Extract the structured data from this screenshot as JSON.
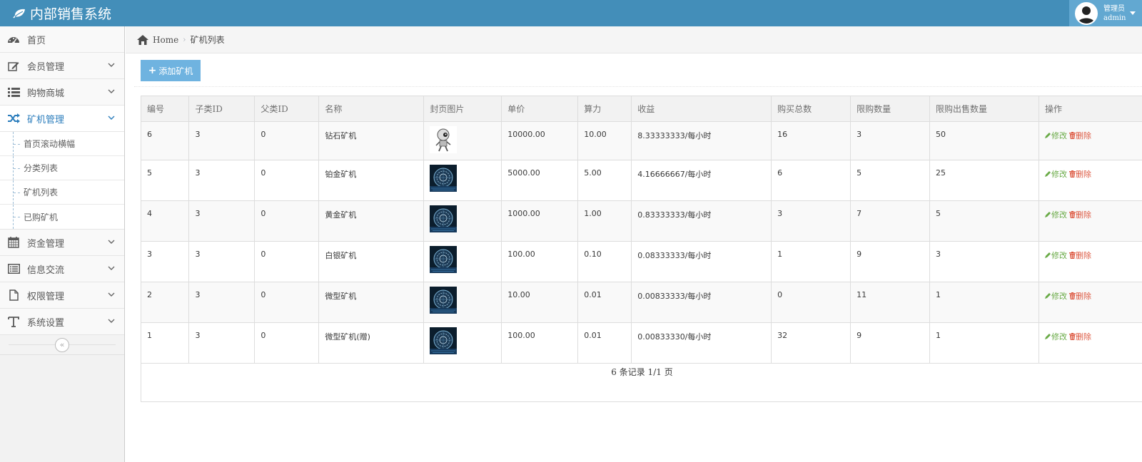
{
  "header": {
    "brand": "内部销售系统",
    "user_role": "管理员",
    "user_name": "admin"
  },
  "sidebar": {
    "items": [
      {
        "label": "首页",
        "icon": "dashboard-icon"
      },
      {
        "label": "会员管理",
        "icon": "edit-icon"
      },
      {
        "label": "购物商城",
        "icon": "list-icon"
      },
      {
        "label": "矿机管理",
        "icon": "shuffle-icon",
        "active": true
      },
      {
        "label": "资金管理",
        "icon": "calendar-icon"
      },
      {
        "label": "信息交流",
        "icon": "list-alt-icon"
      },
      {
        "label": "权限管理",
        "icon": "file-icon"
      },
      {
        "label": "系统设置",
        "icon": "text-icon"
      }
    ],
    "sub_items": [
      "首页滚动横幅",
      "分类列表",
      "矿机列表",
      "已购矿机"
    ],
    "collapse_label": "«"
  },
  "breadcrumb": {
    "home": "Home",
    "current": "矿机列表"
  },
  "toolbar": {
    "add_label": "添加矿机"
  },
  "table": {
    "headers": [
      "编号",
      "子类ID",
      "父类ID",
      "名称",
      "封页图片",
      "单价",
      "算力",
      "收益",
      "购买总数",
      "限购数量",
      "限购出售数量",
      "操作"
    ],
    "rows": [
      {
        "id": "6",
        "sub_id": "3",
        "parent_id": "0",
        "name": "钻石矿机",
        "image": "robot",
        "price": "10000.00",
        "power": "10.00",
        "income": "8.33333333/每小时",
        "total": "16",
        "limit": "3",
        "sell_limit": "50"
      },
      {
        "id": "5",
        "sub_id": "3",
        "parent_id": "0",
        "name": "铂金矿机",
        "image": "orb",
        "price": "5000.00",
        "power": "5.00",
        "income": "4.16666667/每小时",
        "total": "6",
        "limit": "5",
        "sell_limit": "25"
      },
      {
        "id": "4",
        "sub_id": "3",
        "parent_id": "0",
        "name": "黄金矿机",
        "image": "orb",
        "price": "1000.00",
        "power": "1.00",
        "income": "0.83333333/每小时",
        "total": "3",
        "limit": "7",
        "sell_limit": "5"
      },
      {
        "id": "3",
        "sub_id": "3",
        "parent_id": "0",
        "name": "白银矿机",
        "image": "orb",
        "price": "100.00",
        "power": "0.10",
        "income": "0.08333333/每小时",
        "total": "1",
        "limit": "9",
        "sell_limit": "3"
      },
      {
        "id": "2",
        "sub_id": "3",
        "parent_id": "0",
        "name": "微型矿机",
        "image": "orb",
        "price": "10.00",
        "power": "0.01",
        "income": "0.00833333/每小时",
        "total": "0",
        "limit": "11",
        "sell_limit": "1"
      },
      {
        "id": "1",
        "sub_id": "3",
        "parent_id": "0",
        "name": "微型矿机(赠)",
        "image": "orb",
        "price": "100.00",
        "power": "0.01",
        "income": "0.00833330/每小时",
        "total": "32",
        "limit": "9",
        "sell_limit": "1"
      }
    ],
    "edit_label": "修改",
    "delete_label": "删除"
  },
  "pager": {
    "text": "6 条记录 1/1 页"
  },
  "colors": {
    "header": "#438eb9",
    "user_box": "#62a8d1",
    "active_menu": "#2b7dbc",
    "add_button": "#6fb3e0",
    "edit": "#69aa46",
    "delete": "#dd5a43"
  }
}
